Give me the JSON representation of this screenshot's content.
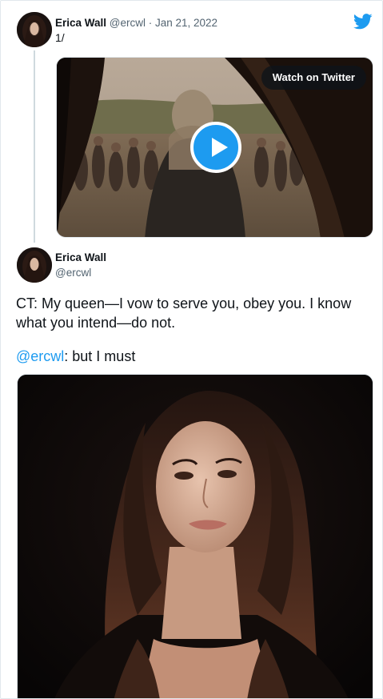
{
  "parent_tweet": {
    "author_name": "Erica Wall",
    "meta": "@ercwl · Jan 21, 2022",
    "text": "1/",
    "video": {
      "watch_label": "Watch on Twitter"
    }
  },
  "main_tweet": {
    "author_name": "Erica Wall",
    "handle": "@ercwl",
    "text": "CT: My queen—I vow to serve you, obey you. I know what you intend—do not.",
    "reply_mention": "@ercwl",
    "reply_text": ": but I must"
  },
  "colors": {
    "link_blue": "#1d9bf0",
    "twitter_brand": "#1d9bf0",
    "secondary_text": "#536471"
  },
  "icons": {
    "brand": "twitter-bird-icon",
    "play": "play-icon"
  }
}
